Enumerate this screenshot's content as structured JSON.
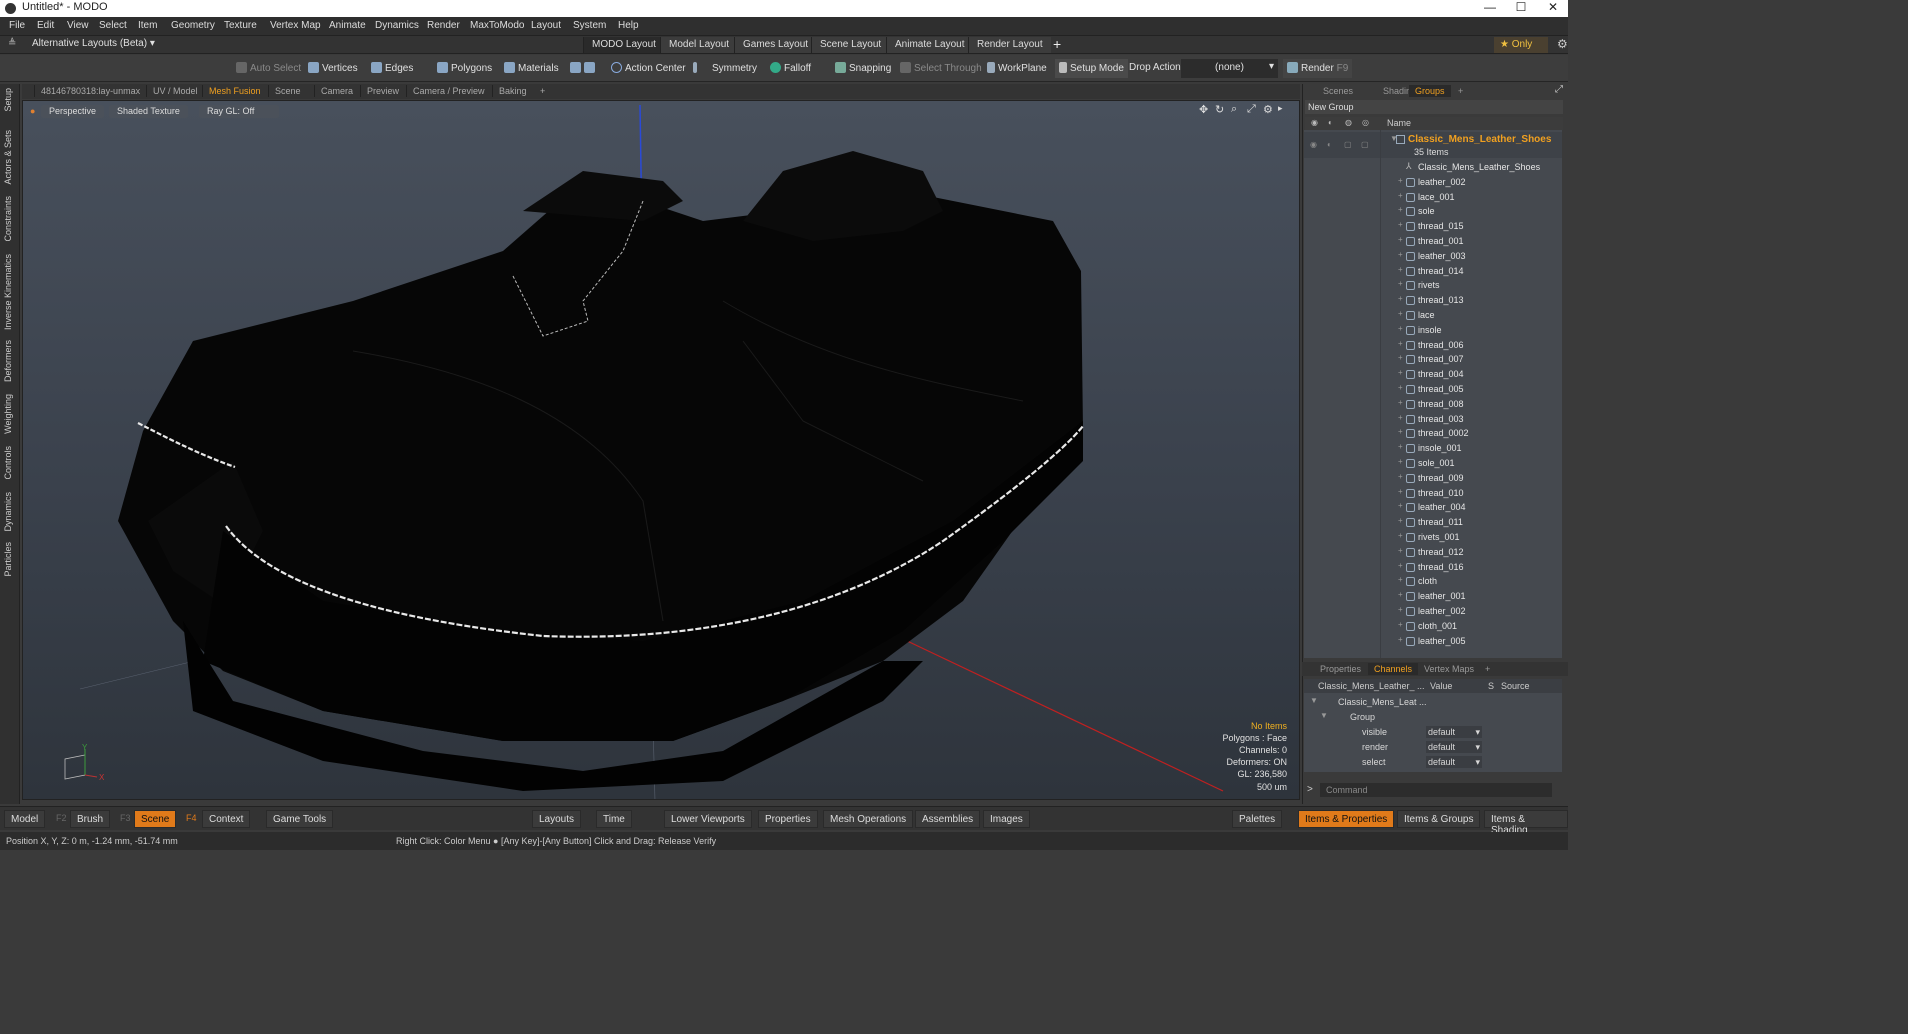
{
  "titlebar": {
    "title": "Untitled* - MODO",
    "minimize": "—",
    "maximize": "☐",
    "close": "✕"
  },
  "menu": [
    "File",
    "Edit",
    "View",
    "Select",
    "Item",
    "Geometry",
    "Texture",
    "Vertex Map",
    "Animate",
    "Dynamics",
    "Render",
    "MaxToModo",
    "Layout",
    "System",
    "Help"
  ],
  "layouts": {
    "dropdown": "Alternative Layouts (Beta) ▾",
    "tabs": [
      "MODO Layout",
      "Model Layout",
      "Games Layout",
      "Scene Layout",
      "Animate Layout",
      "Render Layout"
    ],
    "add": "+",
    "only": "★ Only"
  },
  "toolbar": {
    "auto_select": "Auto Select",
    "vertices": "Vertices",
    "edges": "Edges",
    "polygons": "Polygons",
    "materials": "Materials",
    "action_center": "Action Center",
    "symmetry": "Symmetry",
    "falloff": "Falloff",
    "snapping": "Snapping",
    "select_through": "Select Through",
    "workplane": "WorkPlane",
    "setup_mode": "Setup Mode",
    "drop_action": "Drop Action",
    "drop_value": "(none)",
    "render": "Render",
    "render_key": "F9"
  },
  "lefttabs": [
    "Setup",
    "Actors & Sets",
    "Constraints",
    "Inverse Kinematics",
    "Deformers",
    "Weighting",
    "Controls",
    "Dynamics",
    "Particles"
  ],
  "vptabs": [
    "48146780318:lay-unmax",
    "UV / Model",
    "Mesh Fusion",
    "Scene",
    "Camera",
    "Preview",
    "Camera / Preview",
    "Baking",
    "+"
  ],
  "viewport": {
    "perspective": "Perspective",
    "shading": "Shaded Texture",
    "raygl": "Ray GL: Off",
    "stats": {
      "items": "No Items",
      "polygons": "Polygons : Face",
      "channels": "Channels: 0",
      "deformers": "Deformers: ON",
      "gl": "GL: 236,580",
      "scale": "500 um"
    },
    "axis_y": "Y",
    "axis_x": "X"
  },
  "panel": {
    "tabs": [
      "Scenes",
      "Shading",
      "Groups",
      "+"
    ],
    "new_group": "New Group",
    "name_header": "Name",
    "root": "Classic_Mens_Leather_Shoes",
    "count": "35 Items",
    "items": [
      "Classic_Mens_Leather_Shoes",
      "leather_002",
      "lace_001",
      "sole",
      "thread_015",
      "thread_001",
      "leather_003",
      "thread_014",
      "rivets",
      "thread_013",
      "lace",
      "insole",
      "thread_006",
      "thread_007",
      "thread_004",
      "thread_005",
      "thread_008",
      "thread_003",
      "thread_0002",
      "insole_001",
      "sole_001",
      "thread_009",
      "thread_010",
      "leather_004",
      "thread_011",
      "rivets_001",
      "thread_012",
      "thread_016",
      "cloth",
      "leather_001",
      "leather_002",
      "cloth_001",
      "leather_005"
    ]
  },
  "channels": {
    "tabs": [
      "Properties",
      "Channels",
      "Vertex Maps",
      "+"
    ],
    "headers": {
      "name": "Classic_Mens_Leather_ ...",
      "value": "Value",
      "s": "S",
      "source": "Source"
    },
    "rows": [
      {
        "name": "Classic_Mens_Leat ...",
        "value": ""
      },
      {
        "name": "Group",
        "value": ""
      },
      {
        "name": "visible",
        "value": "default"
      },
      {
        "name": "render",
        "value": "default"
      },
      {
        "name": "select",
        "value": "default"
      }
    ],
    "command": "Command",
    "prompt": ">"
  },
  "bottom": {
    "model": "Model",
    "model_key": "F2",
    "brush": "Brush",
    "brush_key": "F3",
    "scene": "Scene",
    "scene_key": "F4",
    "context": "Context",
    "game_tools": "Game Tools",
    "layouts": "Layouts",
    "time": "Time",
    "lower_viewports": "Lower Viewports",
    "properties": "Properties",
    "mesh_operations": "Mesh Operations",
    "assemblies": "Assemblies",
    "images": "Images",
    "palettes": "Palettes",
    "items_properties": "Items & Properties",
    "items_groups": "Items & Groups",
    "items_shading": "Items & Shading"
  },
  "status": {
    "position": "Position X, Y, Z:  0 m, -1.24 mm, -51.74 mm",
    "hint": "Right Click: Color Menu ● [Any Key]-[Any Button] Click and Drag: Release Verify"
  }
}
